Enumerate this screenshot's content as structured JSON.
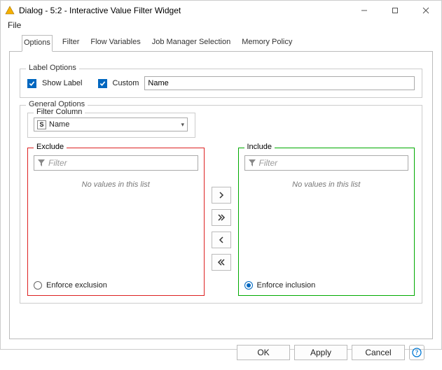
{
  "window": {
    "title": "Dialog - 5:2 - Interactive Value Filter Widget"
  },
  "menu": {
    "file": "File"
  },
  "tabs": {
    "options": "Options",
    "filter": "Filter",
    "flow_variables": "Flow Variables",
    "job_manager": "Job Manager Selection",
    "memory_policy": "Memory Policy"
  },
  "label_options": {
    "legend": "Label Options",
    "show_label": "Show Label",
    "custom": "Custom",
    "name_value": "Name"
  },
  "general_options": {
    "legend": "General Options",
    "filter_column_legend": "Filter Column",
    "filter_column_value": "Name",
    "column_type_badge": "S"
  },
  "lists": {
    "exclude_legend": "Exclude",
    "include_legend": "Include",
    "filter_placeholder": "Filter",
    "empty_msg": "No values in this list",
    "enforce_exclusion": "Enforce exclusion",
    "enforce_inclusion": "Enforce inclusion"
  },
  "movers": {
    "add_one": "❯",
    "add_all": "❯❯",
    "remove_one": "❮",
    "remove_all": "❮❮"
  },
  "buttons": {
    "ok": "OK",
    "apply": "Apply",
    "cancel": "Cancel",
    "help": "?"
  }
}
